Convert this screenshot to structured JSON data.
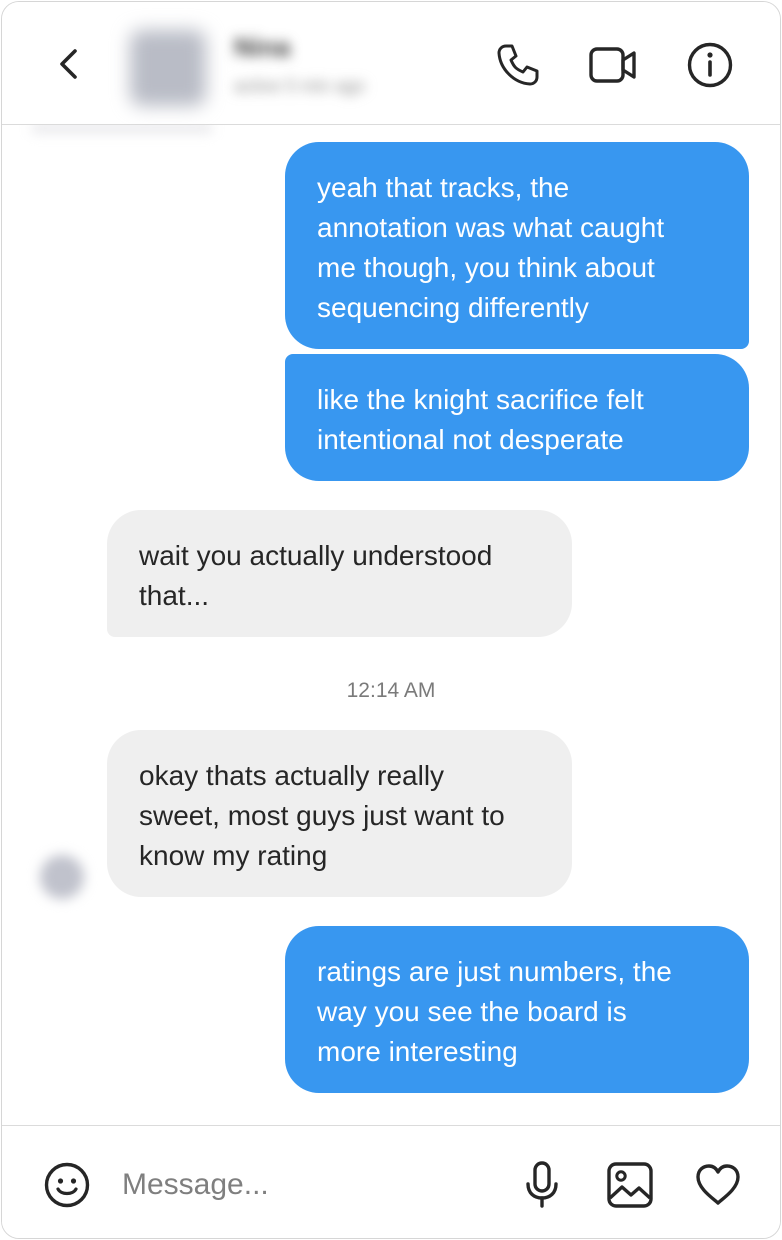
{
  "header": {
    "contact_name": "Nina",
    "contact_sub": "active 5 min ago",
    "icons": [
      "back-icon",
      "phone-icon",
      "video-icon",
      "info-icon"
    ]
  },
  "thread": {
    "messages": [
      {
        "direction": "outgoing",
        "text": "yeah that tracks, the\nannotation was what caught\nme though, you think about\nsequencing differently"
      },
      {
        "direction": "outgoing",
        "text": "like the knight sacrifice felt\nintentional not desperate"
      },
      {
        "direction": "incoming",
        "text": "wait you actually understood\nthat..."
      },
      {
        "direction": "incoming",
        "text": "okay thats actually really\nsweet, most guys just want to\nknow my rating"
      },
      {
        "direction": "outgoing",
        "text": "ratings are just numbers, the\nway you see the board is\nmore interesting"
      }
    ],
    "timestamp": "12:14 AM"
  },
  "composer": {
    "placeholder": "Message...",
    "icons": [
      "emoji-icon",
      "microphone-icon",
      "image-icon",
      "heart-icon"
    ]
  },
  "colors": {
    "outgoing_bubble": "#3897f0",
    "incoming_bubble": "#efefef",
    "border": "#dbdbdb"
  }
}
